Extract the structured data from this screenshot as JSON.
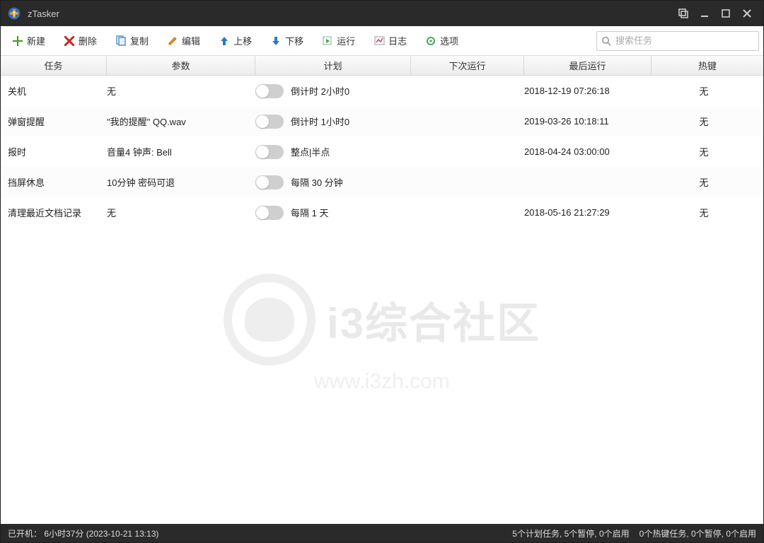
{
  "titlebar": {
    "app_name": "zTasker"
  },
  "toolbar": {
    "new": "新建",
    "delete": "删除",
    "copy": "复制",
    "edit": "编辑",
    "move_up": "上移",
    "move_down": "下移",
    "run": "运行",
    "log": "日志",
    "options": "选项",
    "search_placeholder": "搜索任务"
  },
  "columns": {
    "task": "任务",
    "param": "参数",
    "plan": "计划",
    "next_run": "下次运行",
    "last_run": "最后运行",
    "hotkey": "热键"
  },
  "rows": [
    {
      "task": "关机",
      "param": "无",
      "plan": "倒计时 2小时0",
      "next_run": "",
      "last_run": "2018-12-19 07:26:18",
      "hotkey": "无"
    },
    {
      "task": "弹窗提醒",
      "param": "\"我的提醒\" QQ.wav",
      "plan": "倒计时 1小时0",
      "next_run": "",
      "last_run": "2019-03-26 10:18:11",
      "hotkey": "无"
    },
    {
      "task": "报时",
      "param": "音量4 钟声: Bell",
      "plan": "整点|半点",
      "next_run": "",
      "last_run": "2018-04-24 03:00:00",
      "hotkey": "无"
    },
    {
      "task": "挡屏休息",
      "param": "10分钟 密码可退",
      "plan": "每隔 30 分钟",
      "next_run": "",
      "last_run": "",
      "hotkey": "无"
    },
    {
      "task": "清理最近文档记录",
      "param": "无",
      "plan": "每隔 1 天",
      "next_run": "",
      "last_run": "2018-05-16 21:27:29",
      "hotkey": "无"
    }
  ],
  "watermark": {
    "title": "i3综合社区",
    "subtitle": "www.i3zh.com"
  },
  "status": {
    "uptime": "已开机： 6小时37分 (2023-10-21 13:13)",
    "plan_summary": "5个计划任务, 5个暂停, 0个启用",
    "hotkey_summary": "0个热键任务, 0个暂停, 0个启用"
  }
}
